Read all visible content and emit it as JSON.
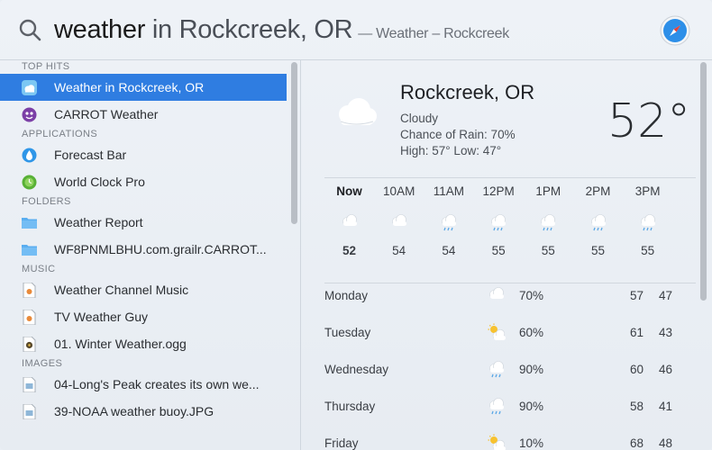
{
  "search": {
    "typed": "weather",
    "completion": " in Rockcreek, OR",
    "hint": "— Weather – Rockcreek"
  },
  "icons": {
    "search": "search-icon",
    "safari": "safari-compass-icon"
  },
  "sections": {
    "top_hits": "TOP HITS",
    "applications": "APPLICATIONS",
    "folders": "FOLDERS",
    "music": "MUSIC",
    "images": "IMAGES"
  },
  "items": {
    "top_hits": [
      {
        "label": "Weather in Rockcreek, OR",
        "icon": "weather-app-icon"
      },
      {
        "label": "CARROT Weather",
        "icon": "carrot-weather-icon"
      }
    ],
    "applications": [
      {
        "label": "Forecast Bar",
        "icon": "forecast-bar-icon"
      },
      {
        "label": "World Clock Pro",
        "icon": "world-clock-icon"
      }
    ],
    "folders": [
      {
        "label": "Weather Report",
        "icon": "folder-icon"
      },
      {
        "label": "WF8PNMLBHU.com.grailr.CARROT...",
        "icon": "folder-icon"
      }
    ],
    "music": [
      {
        "label": "Weather Channel Music",
        "icon": "audio-file-icon"
      },
      {
        "label": "TV Weather Guy",
        "icon": "audio-file-icon"
      },
      {
        "label": "01. Winter Weather.ogg",
        "icon": "ogg-file-icon"
      }
    ],
    "images": [
      {
        "label": "04-Long's Peak creates its own we...",
        "icon": "image-file-icon"
      },
      {
        "label": "39-NOAA weather buoy.JPG",
        "icon": "image-file-icon"
      }
    ]
  },
  "weather": {
    "city": "Rockcreek, OR",
    "condition": "Cloudy",
    "rain": "Chance of Rain: 70%",
    "highlow": "High: 57°  Low: 47°",
    "temp": "52°",
    "hourly": [
      {
        "time": "Now",
        "temp": "52",
        "icon": "cloud"
      },
      {
        "time": "10AM",
        "temp": "54",
        "icon": "cloud"
      },
      {
        "time": "11AM",
        "temp": "54",
        "icon": "rain"
      },
      {
        "time": "12PM",
        "temp": "55",
        "icon": "rain"
      },
      {
        "time": "1PM",
        "temp": "55",
        "icon": "rain"
      },
      {
        "time": "2PM",
        "temp": "55",
        "icon": "rain"
      },
      {
        "time": "3PM",
        "temp": "55",
        "icon": "rain"
      }
    ],
    "daily": [
      {
        "day": "Monday",
        "pct": "70%",
        "hi": "57",
        "lo": "47",
        "icon": "cloud"
      },
      {
        "day": "Tuesday",
        "pct": "60%",
        "hi": "61",
        "lo": "43",
        "icon": "sun-cloud"
      },
      {
        "day": "Wednesday",
        "pct": "90%",
        "hi": "60",
        "lo": "46",
        "icon": "rain"
      },
      {
        "day": "Thursday",
        "pct": "90%",
        "hi": "58",
        "lo": "41",
        "icon": "rain"
      },
      {
        "day": "Friday",
        "pct": "10%",
        "hi": "68",
        "lo": "48",
        "icon": "sun-cloud"
      }
    ]
  },
  "colors": {
    "selection": "#2f7de1",
    "accent": "#2f7de1"
  }
}
